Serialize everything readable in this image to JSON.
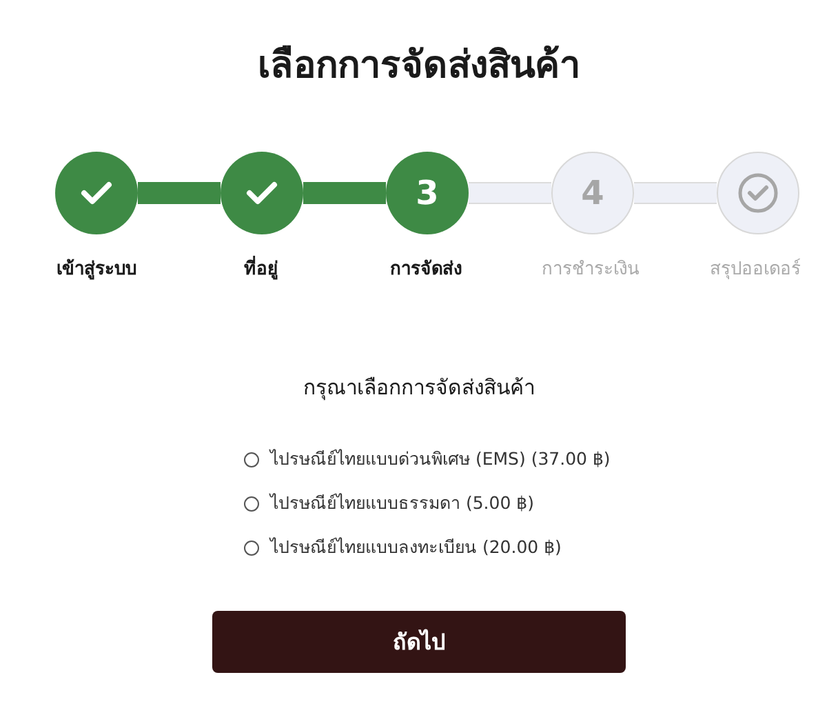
{
  "title": "เลือกการจัดส่งสินค้า",
  "steps": [
    {
      "label": "เข้าสู่ระบบ",
      "kind": "done"
    },
    {
      "label": "ที่อยู่",
      "kind": "done"
    },
    {
      "label": "การจัดส่ง",
      "kind": "current",
      "number": "3"
    },
    {
      "label": "การชำระเงิน",
      "kind": "pending",
      "number": "4"
    },
    {
      "label": "สรุปออเดอร์",
      "kind": "pending"
    }
  ],
  "prompt": "กรุณาเลือกการจัดส่งสินค้า",
  "options": [
    {
      "label": "ไปรษณีย์ไทยแบบด่วนพิเศษ (EMS) (37.00 ฿)",
      "selected": false
    },
    {
      "label": "ไปรษณีย์ไทยแบบธรรมดา (5.00 ฿)",
      "selected": false
    },
    {
      "label": "ไปรษณีย์ไทยแบบลงทะเบียน (20.00 ฿)",
      "selected": false
    }
  ],
  "next_button": "ถัดไป"
}
